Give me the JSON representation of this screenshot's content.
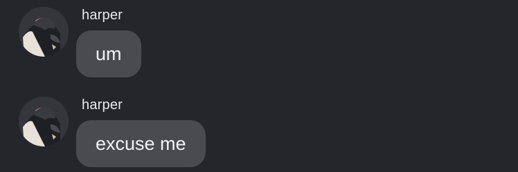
{
  "colors": {
    "background": "#25262b",
    "bubble": "#4a4b51",
    "text": "#f2f2f4",
    "sender": "#e9e9ec"
  },
  "messages": [
    {
      "sender": "harper",
      "text": "um",
      "avatar_icon": "profile-photo-avatar"
    },
    {
      "sender": "harper",
      "text": "excuse me",
      "avatar_icon": "profile-photo-avatar"
    }
  ]
}
